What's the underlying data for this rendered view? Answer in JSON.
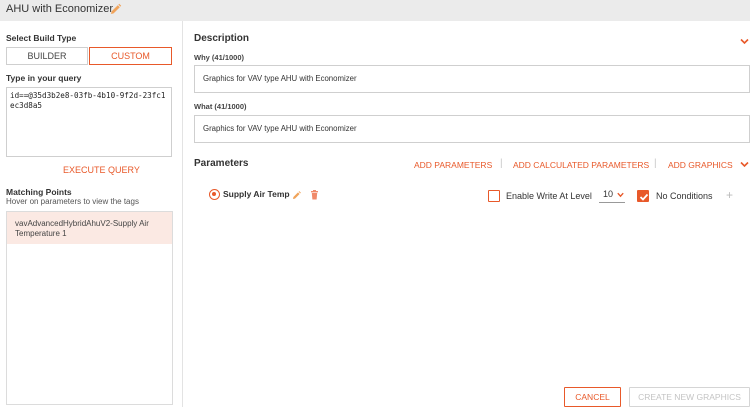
{
  "window": {
    "title": "AHU with Economizer"
  },
  "left": {
    "build_type_label": "Select Build Type",
    "builder_label": "BUILDER",
    "custom_label": "CUSTOM",
    "query_label": "Type in your query",
    "query_value": "id==@35d3b2e8-03fb-4b10-9f2d-23fc1ec3d8a5",
    "execute_label": "EXECUTE QUERY",
    "matching_title": "Matching Points",
    "matching_hint": "Hover on parameters to view the tags",
    "matching_items": [
      "vavAdvancedHybridAhuV2-Supply Air Temperature 1"
    ]
  },
  "description": {
    "title": "Description",
    "why_label": "Why (41/1000)",
    "why_value": "Graphics for VAV type AHU with Economizer",
    "what_label": "What (41/1000)",
    "what_value": "Graphics for VAV type AHU with Economizer"
  },
  "parameters": {
    "title": "Parameters",
    "add_parameters": "ADD PARAMETERS",
    "add_calculated": "ADD CALCULATED PARAMETERS",
    "add_graphics": "ADD GRAPHICS",
    "items": [
      {
        "name": "Supply Air Temp",
        "enable_write_label": "Enable Write At Level",
        "enable_write_checked": false,
        "level": "10",
        "no_conditions_label": "No Conditions",
        "no_conditions_checked": true
      }
    ]
  },
  "footer": {
    "cancel": "CANCEL",
    "create": "CREATE NEW GRAPHICS"
  },
  "colors": {
    "accent": "#e8592a",
    "titlebar": "#ebebeb",
    "selected_row": "#fbe9e3"
  }
}
